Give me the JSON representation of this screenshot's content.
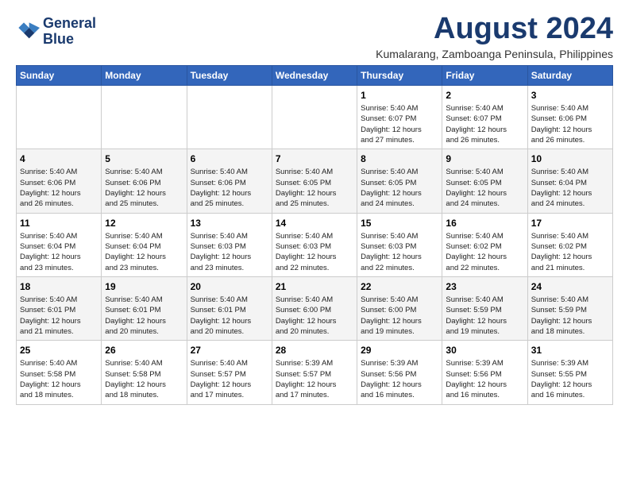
{
  "header": {
    "logo_line1": "General",
    "logo_line2": "Blue",
    "title": "August 2024",
    "subtitle": "Kumalarang, Zamboanga Peninsula, Philippines"
  },
  "calendar": {
    "days_of_week": [
      "Sunday",
      "Monday",
      "Tuesday",
      "Wednesday",
      "Thursday",
      "Friday",
      "Saturday"
    ],
    "weeks": [
      [
        {
          "day": "",
          "info": ""
        },
        {
          "day": "",
          "info": ""
        },
        {
          "day": "",
          "info": ""
        },
        {
          "day": "",
          "info": ""
        },
        {
          "day": "1",
          "info": "Sunrise: 5:40 AM\nSunset: 6:07 PM\nDaylight: 12 hours\nand 27 minutes."
        },
        {
          "day": "2",
          "info": "Sunrise: 5:40 AM\nSunset: 6:07 PM\nDaylight: 12 hours\nand 26 minutes."
        },
        {
          "day": "3",
          "info": "Sunrise: 5:40 AM\nSunset: 6:06 PM\nDaylight: 12 hours\nand 26 minutes."
        }
      ],
      [
        {
          "day": "4",
          "info": "Sunrise: 5:40 AM\nSunset: 6:06 PM\nDaylight: 12 hours\nand 26 minutes."
        },
        {
          "day": "5",
          "info": "Sunrise: 5:40 AM\nSunset: 6:06 PM\nDaylight: 12 hours\nand 25 minutes."
        },
        {
          "day": "6",
          "info": "Sunrise: 5:40 AM\nSunset: 6:06 PM\nDaylight: 12 hours\nand 25 minutes."
        },
        {
          "day": "7",
          "info": "Sunrise: 5:40 AM\nSunset: 6:05 PM\nDaylight: 12 hours\nand 25 minutes."
        },
        {
          "day": "8",
          "info": "Sunrise: 5:40 AM\nSunset: 6:05 PM\nDaylight: 12 hours\nand 24 minutes."
        },
        {
          "day": "9",
          "info": "Sunrise: 5:40 AM\nSunset: 6:05 PM\nDaylight: 12 hours\nand 24 minutes."
        },
        {
          "day": "10",
          "info": "Sunrise: 5:40 AM\nSunset: 6:04 PM\nDaylight: 12 hours\nand 24 minutes."
        }
      ],
      [
        {
          "day": "11",
          "info": "Sunrise: 5:40 AM\nSunset: 6:04 PM\nDaylight: 12 hours\nand 23 minutes."
        },
        {
          "day": "12",
          "info": "Sunrise: 5:40 AM\nSunset: 6:04 PM\nDaylight: 12 hours\nand 23 minutes."
        },
        {
          "day": "13",
          "info": "Sunrise: 5:40 AM\nSunset: 6:03 PM\nDaylight: 12 hours\nand 23 minutes."
        },
        {
          "day": "14",
          "info": "Sunrise: 5:40 AM\nSunset: 6:03 PM\nDaylight: 12 hours\nand 22 minutes."
        },
        {
          "day": "15",
          "info": "Sunrise: 5:40 AM\nSunset: 6:03 PM\nDaylight: 12 hours\nand 22 minutes."
        },
        {
          "day": "16",
          "info": "Sunrise: 5:40 AM\nSunset: 6:02 PM\nDaylight: 12 hours\nand 22 minutes."
        },
        {
          "day": "17",
          "info": "Sunrise: 5:40 AM\nSunset: 6:02 PM\nDaylight: 12 hours\nand 21 minutes."
        }
      ],
      [
        {
          "day": "18",
          "info": "Sunrise: 5:40 AM\nSunset: 6:01 PM\nDaylight: 12 hours\nand 21 minutes."
        },
        {
          "day": "19",
          "info": "Sunrise: 5:40 AM\nSunset: 6:01 PM\nDaylight: 12 hours\nand 20 minutes."
        },
        {
          "day": "20",
          "info": "Sunrise: 5:40 AM\nSunset: 6:01 PM\nDaylight: 12 hours\nand 20 minutes."
        },
        {
          "day": "21",
          "info": "Sunrise: 5:40 AM\nSunset: 6:00 PM\nDaylight: 12 hours\nand 20 minutes."
        },
        {
          "day": "22",
          "info": "Sunrise: 5:40 AM\nSunset: 6:00 PM\nDaylight: 12 hours\nand 19 minutes."
        },
        {
          "day": "23",
          "info": "Sunrise: 5:40 AM\nSunset: 5:59 PM\nDaylight: 12 hours\nand 19 minutes."
        },
        {
          "day": "24",
          "info": "Sunrise: 5:40 AM\nSunset: 5:59 PM\nDaylight: 12 hours\nand 18 minutes."
        }
      ],
      [
        {
          "day": "25",
          "info": "Sunrise: 5:40 AM\nSunset: 5:58 PM\nDaylight: 12 hours\nand 18 minutes."
        },
        {
          "day": "26",
          "info": "Sunrise: 5:40 AM\nSunset: 5:58 PM\nDaylight: 12 hours\nand 18 minutes."
        },
        {
          "day": "27",
          "info": "Sunrise: 5:40 AM\nSunset: 5:57 PM\nDaylight: 12 hours\nand 17 minutes."
        },
        {
          "day": "28",
          "info": "Sunrise: 5:39 AM\nSunset: 5:57 PM\nDaylight: 12 hours\nand 17 minutes."
        },
        {
          "day": "29",
          "info": "Sunrise: 5:39 AM\nSunset: 5:56 PM\nDaylight: 12 hours\nand 16 minutes."
        },
        {
          "day": "30",
          "info": "Sunrise: 5:39 AM\nSunset: 5:56 PM\nDaylight: 12 hours\nand 16 minutes."
        },
        {
          "day": "31",
          "info": "Sunrise: 5:39 AM\nSunset: 5:55 PM\nDaylight: 12 hours\nand 16 minutes."
        }
      ]
    ]
  }
}
